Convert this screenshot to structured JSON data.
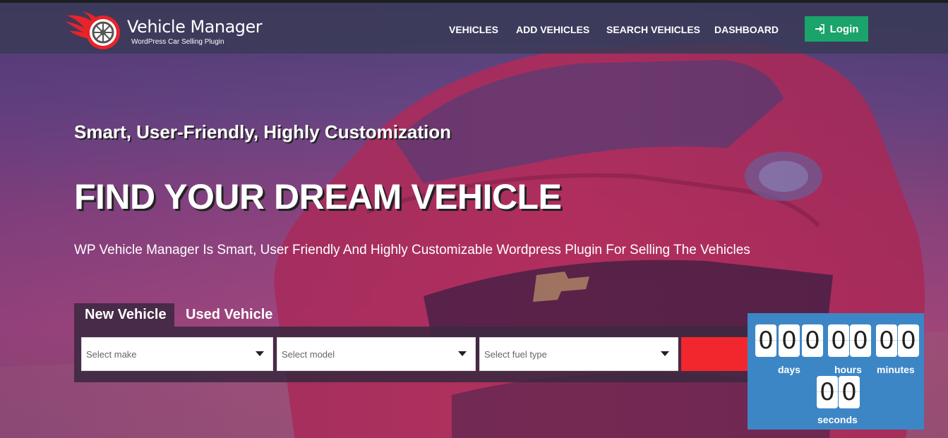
{
  "brand": {
    "title": "Vehicle Manager",
    "subtitle": "WordPress Car Selling Plugin",
    "logo_icon": "wheel-flame-icon",
    "accent": "#e8232a"
  },
  "nav": {
    "items": [
      "VEHICLES",
      "ADD VEHICLES",
      "SEARCH VEHICLES",
      "DASHBOARD"
    ],
    "login_label": "Login",
    "login_icon": "sign-in-icon",
    "login_color": "#1aa36a"
  },
  "hero": {
    "tagline": "Smart, User-Friendly, Highly Customization",
    "headline": "FIND YOUR DREAM VEHICLE",
    "description": "WP Vehicle Manager Is Smart, User Friendly And Highly Customizable Wordpress Plugin For Selling The Vehicles"
  },
  "search": {
    "tabs": [
      "New Vehicle",
      "Used Vehicle"
    ],
    "active_tab": "New Vehicle",
    "make_placeholder": "Select make",
    "model_placeholder": "Select model",
    "fuel_placeholder": "Select fuel type",
    "button_color": "#f2272d"
  },
  "countdown": {
    "days": [
      "0",
      "0",
      "0"
    ],
    "hours": [
      "0",
      "0"
    ],
    "minutes": [
      "0",
      "0"
    ],
    "seconds": [
      "0",
      "0"
    ],
    "days_label": "days",
    "hours_label": "hours",
    "minutes_label": "minutes",
    "seconds_label": "seconds",
    "color": "#3d86c6"
  }
}
